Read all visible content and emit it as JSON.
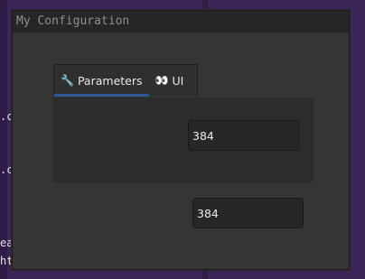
{
  "background": {
    "text_fragments": [
      ".c",
      ".c",
      "ea",
      "ht"
    ]
  },
  "window": {
    "title": "My Configuration"
  },
  "tabs": [
    {
      "icon": "🔧",
      "icon_name": "wrench-icon",
      "label": "Parameters",
      "active": true
    },
    {
      "icon": "👀",
      "icon_name": "eyes-icon",
      "label": "UI",
      "active": false
    }
  ],
  "fields": {
    "tab_field_value": "384",
    "window_field_value": "384"
  },
  "colors": {
    "accent": "#2d5a97",
    "background": "#3a2458"
  }
}
